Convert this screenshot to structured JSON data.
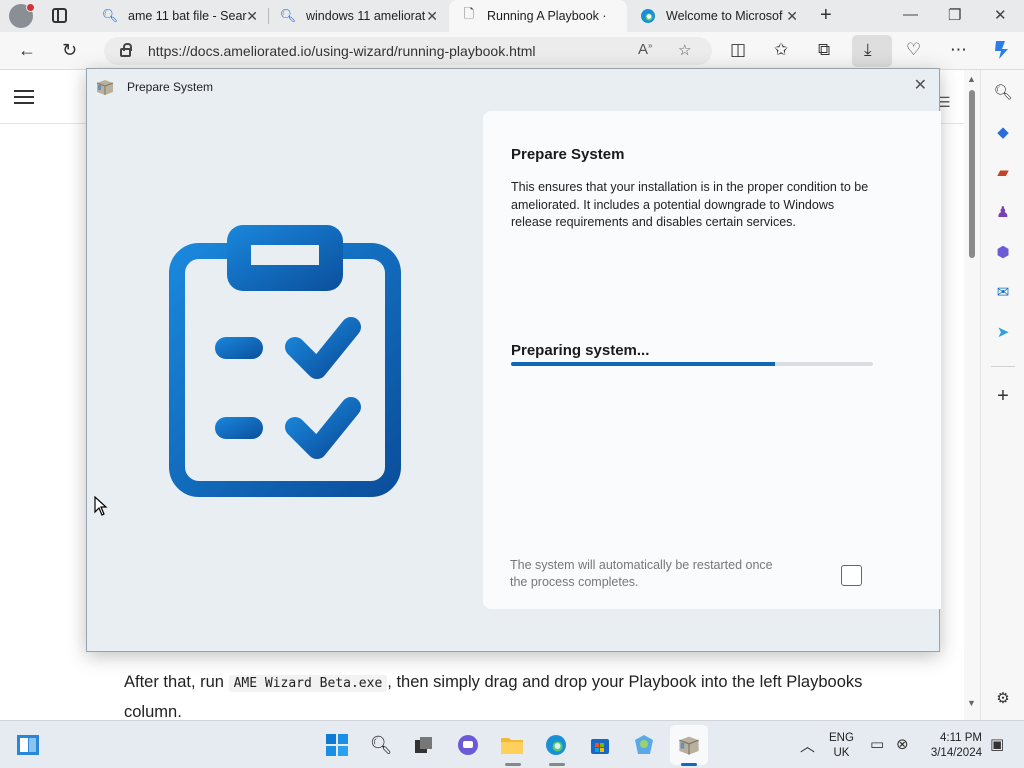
{
  "browser": {
    "tabs": [
      {
        "label": "ame 11 bat file - Sear",
        "icon": "search-icon"
      },
      {
        "label": "windows 11 ameliorat",
        "icon": "search-icon"
      },
      {
        "label": "Running A Playbook ·",
        "icon": "page-icon"
      },
      {
        "label": "Welcome to Microsof",
        "icon": "edge-icon"
      }
    ],
    "active_tab": 2,
    "url": "https://docs.ameliorated.io/using-wizard/running-playbook.html"
  },
  "page": {
    "text_before": "After that, run ",
    "code": "AME Wizard Beta.exe",
    "text_after": ", then simply drag and drop your Playbook into the left Playbooks column."
  },
  "dialog": {
    "window_title": "Prepare System",
    "heading": "Prepare System",
    "description": "This ensures that your installation is in the proper condition to be ameliorated. It includes a potential downgrade to Windows release requirements and disables certain services.",
    "status": "Preparing system...",
    "progress_percent": 73,
    "restart_note": "The system will automatically be restarted once the process completes.",
    "restart_checked": false,
    "accent_color": "#1167b1"
  },
  "taskbar": {
    "language": "ENG",
    "region": "UK",
    "time": "4:11 PM",
    "date": "3/14/2024"
  }
}
